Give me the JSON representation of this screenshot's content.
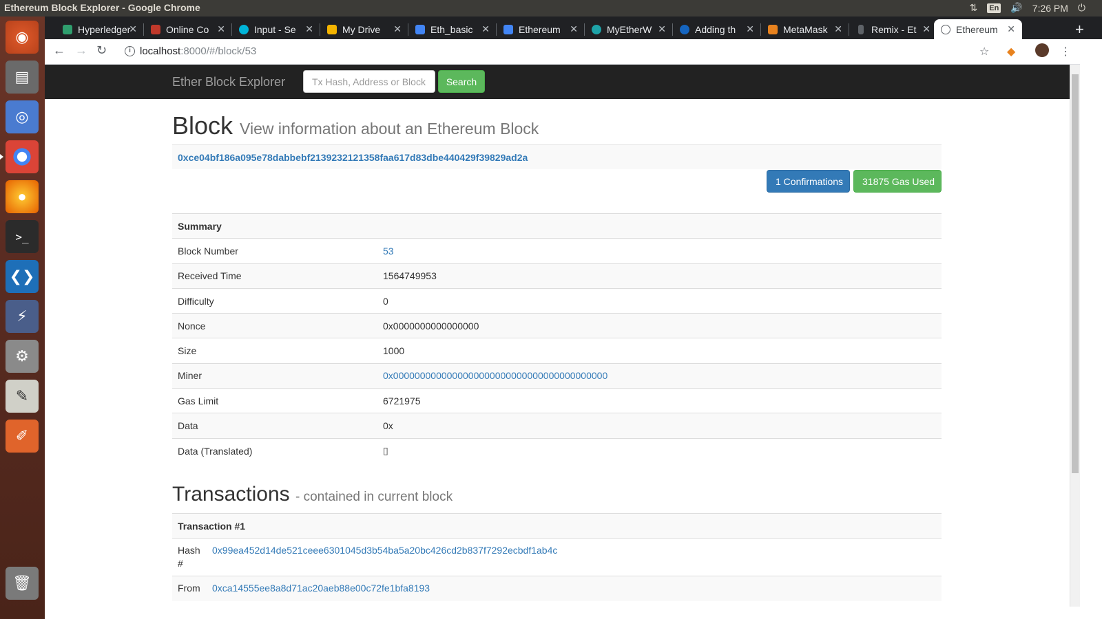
{
  "os": {
    "window_title": "Ethereum Block Explorer - Google Chrome",
    "lang": "En",
    "clock": "7:26 PM"
  },
  "browser": {
    "tabs": [
      {
        "label": "Hyperledger",
        "color": "#2f9e6e"
      },
      {
        "label": "Online Co",
        "color": "#c0392b"
      },
      {
        "label": "Input - Se",
        "color": "#00b4d8"
      },
      {
        "label": "My Drive",
        "color": "#f4b400"
      },
      {
        "label": "Eth_basic",
        "color": "#4285f4"
      },
      {
        "label": "Ethereum",
        "color": "#4285f4"
      },
      {
        "label": "MyEtherW",
        "color": "#1ea3a8"
      },
      {
        "label": "Adding th",
        "color": "#1565c0"
      },
      {
        "label": "MetaMask",
        "color": "#e8821e"
      },
      {
        "label": "Remix - Et",
        "color": "#5f6368"
      },
      {
        "label": "Ethereum",
        "color": "#5f6368"
      }
    ],
    "url_host": "localhost",
    "url_path": ":8000/#/block/53"
  },
  "navbar": {
    "brand": "Ether Block Explorer",
    "search_placeholder": "Tx Hash, Address or Block",
    "search_label": "Search"
  },
  "block": {
    "title": "Block",
    "subtitle": "View information about an Ethereum Block",
    "hash": "0xce04bf186a095e78dabbebf2139232121358faa617d83dbe440429f39829ad2a",
    "confirmations_label": "1 Confirmations",
    "gas_used_label": "31875 Gas Used",
    "summary_header": "Summary",
    "rows": [
      {
        "key": "Block Number",
        "value": "53"
      },
      {
        "key": "Received Time",
        "value": "1564749953"
      },
      {
        "key": "Difficulty",
        "value": "0"
      },
      {
        "key": "Nonce",
        "value": "0x0000000000000000"
      },
      {
        "key": "Size",
        "value": "1000"
      },
      {
        "key": "Miner",
        "value": "0x0000000000000000000000000000000000000000"
      },
      {
        "key": "Gas Limit",
        "value": "6721975"
      },
      {
        "key": "Data",
        "value": "0x"
      },
      {
        "key": "Data (Translated)",
        "value": "▯"
      }
    ]
  },
  "transactions": {
    "title": "Transactions",
    "subtitle": "- contained in current block",
    "items": [
      {
        "header": "Transaction #1",
        "hash_key": "Hash #",
        "hash": "0x99ea452d14de521ceee6301045d3b54ba5a20bc426cd2b837f7292ecbdf1ab4c",
        "from_key": "From",
        "from": "0xca14555ee8a8d71ac20aeb88e00c72fe1bfa8193"
      }
    ]
  }
}
